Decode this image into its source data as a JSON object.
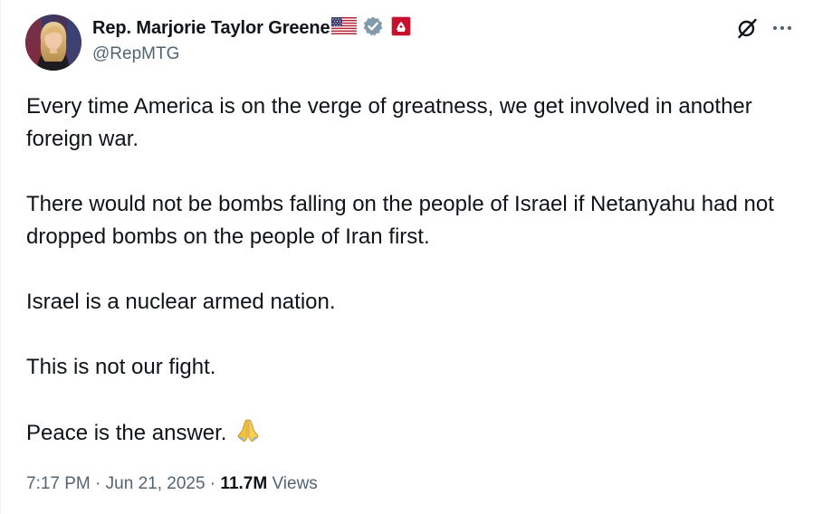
{
  "author": {
    "display_name": "Rep. Marjorie Taylor Greene",
    "handle": "@RepMTG",
    "badges": [
      "us-flag-icon",
      "verified-icon",
      "affiliation-icon"
    ],
    "verified_color": "#829aab",
    "affiliation_color": "#c8102e"
  },
  "actions": {
    "grok_icon": "grok-icon",
    "more_icon": "more-icon"
  },
  "tweet": {
    "paragraphs": [
      "Every time America is on the verge of greatness, we get involved in another foreign war.",
      "There would not be bombs falling on the people of Israel if Netanyahu had not dropped bombs on the people of Iran first.",
      "Israel is a nuclear armed nation.",
      "This is not our fight.",
      "Peace is the answer."
    ],
    "trailing_emoji": "folded-hands-icon"
  },
  "meta": {
    "time": "7:17 PM",
    "separator": " · ",
    "date": "Jun 21, 2025",
    "views_count": "11.7M",
    "views_label": "Views"
  }
}
